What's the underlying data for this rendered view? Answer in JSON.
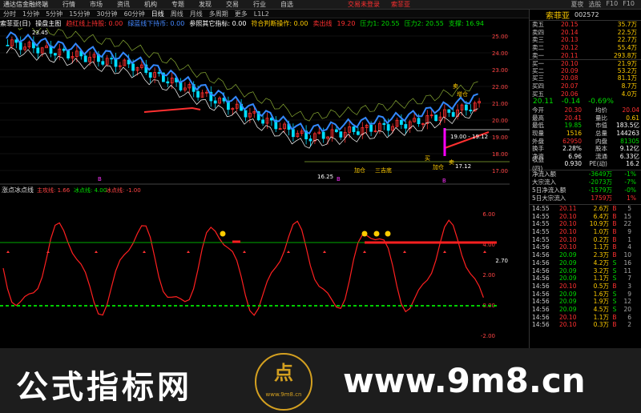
{
  "titlebar": {
    "logo": "通达信金融终端",
    "menu": [
      "行情",
      "市场",
      "资讯",
      "机构",
      "专题",
      "发现",
      "交易",
      "行业",
      "自选"
    ],
    "notice1": "交易未登录",
    "notice2": "索菲亚",
    "right": [
      "夏夜",
      "选股",
      "F10",
      "F10"
    ]
  },
  "toolbar": {
    "items": [
      "分时",
      "1分钟",
      "5分钟",
      "15分钟",
      "30分钟",
      "60分钟",
      "日线",
      "周线",
      "月线",
      "多周期",
      "更多"
    ],
    "active_index": 6,
    "extra": "L1L2"
  },
  "infobar": {
    "stock": "索菲亚(日)",
    "main": "操盘主图",
    "s1": "趋红线上持股: 0.00",
    "s2": "绿蓝线下持币: 0.00",
    "s3": "参照其它指标: 0.00",
    "s4": "符合判断操作: 0.00",
    "s5": "卖出线",
    "v1": "19.20",
    "p1": "压力1: 20.55",
    "p2": "压力2: 20.55",
    "p3": "支撑: 16.94"
  },
  "chart": {
    "price_labels": [
      "25.00",
      "24.00",
      "23.00",
      "22.00",
      "21.00",
      "20.00",
      "19.00",
      "18.00",
      "17.00"
    ],
    "annot_low": "16.25",
    "annot_high": "23.45",
    "ann_mid": "19.00 - 19.12",
    "ann_low2": "17.12",
    "labels_b": [
      "B",
      "B",
      "B"
    ],
    "labels_k": [
      "卖",
      "增仓"
    ],
    "sub_title": "涨点冰点线",
    "sub_s1": "主攻线: 1.66",
    "sub_s2": "冰点线: 4.00",
    "sub_s3": "冰点线: -1.00",
    "sub_labels": [
      "6.00",
      "4.00",
      "2.00",
      "0.00",
      "-2.00"
    ],
    "sub_tag": "2.70",
    "marker_texts": [
      "加仓",
      "三吉底",
      "买",
      "加仓",
      "卖"
    ]
  },
  "quote": {
    "name": "索菲亚",
    "code": "002572",
    "price": "20.11",
    "change": "-0.14",
    "pct": "-0.69%"
  },
  "orderbook": [
    {
      "l": "卖五",
      "p": "20.15",
      "v": "35.7万",
      "c": "red"
    },
    {
      "l": "卖四",
      "p": "20.14",
      "v": "22.5万",
      "c": "red"
    },
    {
      "l": "卖三",
      "p": "20.13",
      "v": "22.7万",
      "c": "red"
    },
    {
      "l": "卖二",
      "p": "20.12",
      "v": "55.4万",
      "c": "red"
    },
    {
      "l": "卖一",
      "p": "20.11",
      "v": "293.8万",
      "c": "red"
    },
    {
      "l": "买一",
      "p": "20.10",
      "v": "21.9万",
      "c": "red"
    },
    {
      "l": "买二",
      "p": "20.09",
      "v": "53.2万",
      "c": "red"
    },
    {
      "l": "买三",
      "p": "20.08",
      "v": "81.1万",
      "c": "red"
    },
    {
      "l": "买四",
      "p": "20.07",
      "v": "8.7万",
      "c": "red"
    },
    {
      "l": "买五",
      "p": "20.06",
      "v": "4.0万",
      "c": "red"
    }
  ],
  "stats": [
    {
      "k1": "今开",
      "v1": "20.30",
      "c1": "red",
      "k2": "均价",
      "v2": "20.04",
      "c2": "red"
    },
    {
      "k1": "最高",
      "v1": "20.41",
      "c1": "red",
      "k2": "量比",
      "v2": "0.61",
      "c2": "yellow"
    },
    {
      "k1": "最低",
      "v1": "19.85",
      "c1": "green",
      "k2": "市值",
      "v2": "183.5亿",
      "c2": "white"
    },
    {
      "k1": "现量",
      "v1": "1516",
      "c1": "yellow",
      "k2": "总量",
      "v2": "144263",
      "c2": "white"
    },
    {
      "k1": "外盘",
      "v1": "62950",
      "c1": "red",
      "k2": "内盘",
      "v2": "81305",
      "c2": "green"
    },
    {
      "k1": "换手",
      "v1": "2.28%",
      "c1": "white",
      "k2": "股本",
      "v2": "9.12亿",
      "c2": "white"
    },
    {
      "k1": "净资",
      "v1": "6.96",
      "c1": "white",
      "k2": "流通",
      "v2": "6.33亿",
      "c2": "white"
    },
    {
      "k1": "收益(四)",
      "v1": "0.930",
      "c1": "white",
      "k2": "PE(动)",
      "v2": "16.2",
      "c2": "white"
    }
  ],
  "funds": [
    {
      "k": "净流入额",
      "v": "-3649万",
      "pct": "-1%"
    },
    {
      "k": "大宗流入",
      "v": "-2073万",
      "pct": "-7%"
    },
    {
      "k": "5日净流入额",
      "v": "-1579万",
      "pct": "-0%"
    },
    {
      "k": "5日大宗流入",
      "v": "1759万",
      "pct": "1%"
    }
  ],
  "ticks": [
    {
      "t": "14:55",
      "p": "20.11",
      "v": "2.6万",
      "f": "B",
      "n": "5"
    },
    {
      "t": "14:55",
      "p": "20.10",
      "v": "6.4万",
      "f": "B",
      "n": "15"
    },
    {
      "t": "14:55",
      "p": "20.10",
      "v": "10.9万",
      "f": "B",
      "n": "22"
    },
    {
      "t": "14:55",
      "p": "20.10",
      "v": "1.0万",
      "f": "B",
      "n": "9"
    },
    {
      "t": "14:55",
      "p": "20.10",
      "v": "0.2万",
      "f": "B",
      "n": "1"
    },
    {
      "t": "14:56",
      "p": "20.10",
      "v": "1.1万",
      "f": "B",
      "n": "4"
    },
    {
      "t": "14:56",
      "p": "20.09",
      "v": "2.3万",
      "f": "B",
      "n": "10"
    },
    {
      "t": "14:56",
      "p": "20.09",
      "v": "4.2万",
      "f": "S",
      "n": "16"
    },
    {
      "t": "14:56",
      "p": "20.09",
      "v": "3.2万",
      "f": "S",
      "n": "11"
    },
    {
      "t": "14:56",
      "p": "20.09",
      "v": "1.1万",
      "f": "S",
      "n": "7"
    },
    {
      "t": "14:56",
      "p": "20.10",
      "v": "0.5万",
      "f": "B",
      "n": "3"
    },
    {
      "t": "14:56",
      "p": "20.09",
      "v": "1.6万",
      "f": "S",
      "n": "9"
    },
    {
      "t": "14:56",
      "p": "20.09",
      "v": "1.9万",
      "f": "S",
      "n": "12"
    },
    {
      "t": "14:56",
      "p": "20.09",
      "v": "4.5万",
      "f": "S",
      "n": "20"
    },
    {
      "t": "14:56",
      "p": "20.10",
      "v": "1.1万",
      "f": "B",
      "n": "6"
    },
    {
      "t": "14:56",
      "p": "20.10",
      "v": "0.3万",
      "f": "B",
      "n": "2"
    }
  ],
  "watermark": {
    "left": "公式指标网",
    "right": "www.9m8.cn",
    "seal": "点",
    "seal_small": "www.9m8.cn"
  }
}
